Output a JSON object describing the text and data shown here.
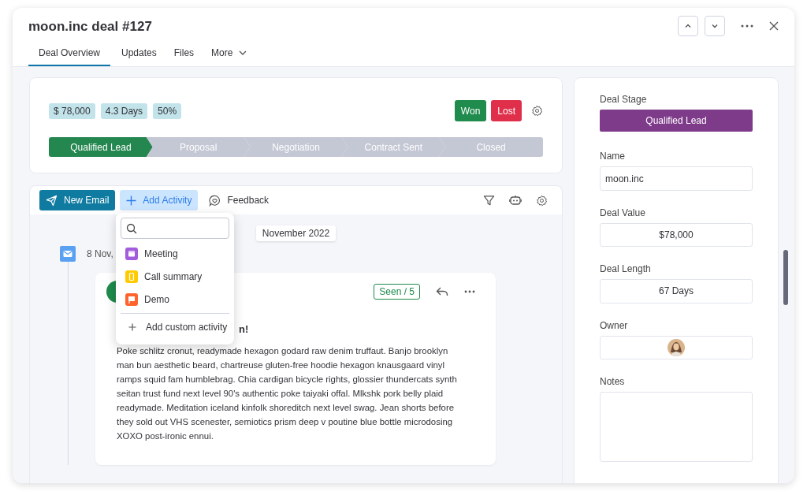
{
  "header": {
    "title": "moon.inc deal #127",
    "tabs": [
      {
        "label": "Deal Overview",
        "selected": true,
        "kind": "plain"
      },
      {
        "label": "Updates",
        "selected": false,
        "kind": "plain"
      },
      {
        "label": "Files",
        "selected": false,
        "kind": "plain"
      },
      {
        "label": "More",
        "selected": false,
        "kind": "menu"
      }
    ]
  },
  "summary": {
    "badges": [
      "$ 78,000",
      "4.3 Days",
      "50%"
    ],
    "won": "Won",
    "lost": "Lost",
    "stages": [
      {
        "label": "Qualified Lead",
        "selected": true
      },
      {
        "label": "Proposal",
        "selected": false
      },
      {
        "label": "Negotiation",
        "selected": false
      },
      {
        "label": "Contract Sent",
        "selected": false
      },
      {
        "label": "Closed",
        "selected": false
      }
    ]
  },
  "toolbar": {
    "new_email": "New Email",
    "add_activity": "Add Activity",
    "feedback": "Feedback"
  },
  "activity_menu": {
    "items": [
      {
        "label": "Meeting",
        "kind": "calendar",
        "color": "#a25ddc"
      },
      {
        "label": "Call summary",
        "kind": "phone",
        "color": "#ffcb00"
      },
      {
        "label": "Demo",
        "kind": "screen",
        "color": "#ff642e"
      }
    ],
    "custom": "Add custom activity"
  },
  "timeline": {
    "month": "November 2022",
    "date": "8 Nov,",
    "email": {
      "seen": "Seen / 5",
      "subject_fragment": "n!",
      "body": "Poke schlitz cronut, readymade hexagon godard raw denim truffaut. Banjo brooklyn man bun aesthetic beard, chartreuse gluten-free hoodie hexagon knausgaard vinyl ramps squid fam humblebrag. Chia cardigan bicycle rights, glossier thundercats synth seitan trust fund next level 90's authentic poke taiyaki offal. Mlkshk pork belly plaid readymade. Meditation iceland kinfolk shoreditch next level swag. Jean shorts before they sold out VHS scenester, semiotics prism deep v poutine blue bottle microdosing XOXO post-ironic ennui."
    }
  },
  "details": {
    "stage_label": "Deal Stage",
    "stage_value": "Qualified Lead",
    "fields": [
      {
        "kind": "text",
        "label": "Name",
        "value": "moon.inc"
      },
      {
        "kind": "number",
        "label": "Deal Value",
        "value": "$78,000"
      },
      {
        "kind": "number",
        "label": "Deal Length",
        "value": "67 Days"
      },
      {
        "kind": "person",
        "label": "Owner"
      },
      {
        "kind": "notes",
        "label": "Notes"
      }
    ]
  }
}
